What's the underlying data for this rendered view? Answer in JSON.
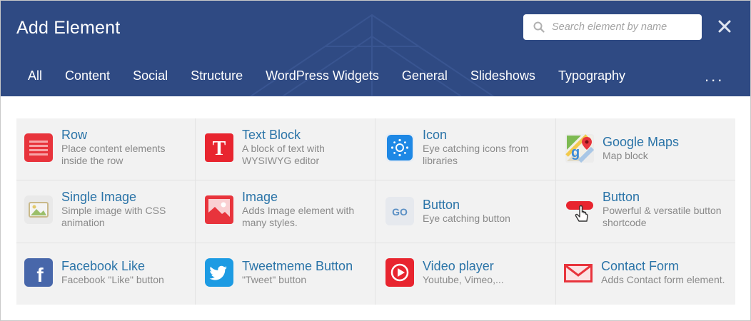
{
  "header": {
    "title": "Add Element",
    "search_placeholder": "Search element by name",
    "search_value": "",
    "tabs": [
      "All",
      "Content",
      "Social",
      "Structure",
      "WordPress Widgets",
      "General",
      "Slideshows",
      "Typography"
    ],
    "more_label": "..."
  },
  "colors": {
    "header_bg": "#2f4a83",
    "grid_bg": "#f2f2f2",
    "element_name": "#2b74a8",
    "element_desc": "#8a8a8a",
    "red_accent": "#e8343c"
  },
  "elements": [
    {
      "name": "Row",
      "desc_1": "Place content elements",
      "desc_2": "inside the row",
      "icon": "row-icon"
    },
    {
      "name": "Text Block",
      "desc_1": "A block of text with",
      "desc_2": "WYSIWYG editor",
      "icon": "text-block-icon",
      "icon_letter": "T"
    },
    {
      "name": "Icon",
      "desc_1": "Eye catching icons from",
      "desc_2": "libraries",
      "icon": "icon-element-icon"
    },
    {
      "name": "Google Maps",
      "desc_1": "Map block",
      "desc_2": "",
      "icon": "google-maps-icon"
    },
    {
      "name": "Single Image",
      "desc_1": "Simple image with CSS",
      "desc_2": "animation",
      "icon": "single-image-icon"
    },
    {
      "name": "Image",
      "desc_1": "Adds Image element with",
      "desc_2": "many styles.",
      "icon": "image-icon"
    },
    {
      "name": "Button",
      "desc_1": "Eye catching button",
      "desc_2": "",
      "icon": "go-button-icon",
      "icon_letter": "GO"
    },
    {
      "name": "Button",
      "desc_1": "Powerful & versatile button",
      "desc_2": "shortcode",
      "icon": "pointer-button-icon"
    },
    {
      "name": "Facebook Like",
      "desc_1": "Facebook \"Like\" button",
      "desc_2": "",
      "icon": "facebook-icon",
      "icon_letter": "f"
    },
    {
      "name": "Tweetmeme Button",
      "desc_1": "\"Tweet\" button",
      "desc_2": "",
      "icon": "twitter-icon"
    },
    {
      "name": "Video player",
      "desc_1": "Youtube, Vimeo,...",
      "desc_2": "",
      "icon": "video-player-icon"
    },
    {
      "name": "Contact Form",
      "desc_1": "Adds Contact form element.",
      "desc_2": "",
      "icon": "contact-form-icon"
    }
  ]
}
